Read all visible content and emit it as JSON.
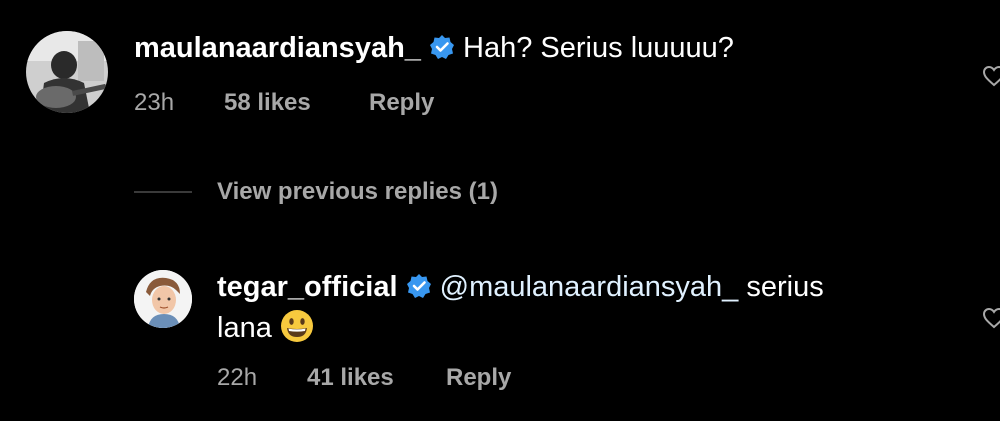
{
  "comment": {
    "username": "maulanaardiansyah_",
    "text": "Hah? Serius luuuuu?",
    "time": "23h",
    "likes": "58 likes",
    "reply_label": "Reply",
    "avatar_icon": "user-photo-guitar",
    "verified_icon": "verified-badge-icon",
    "like_icon": "heart-outline-icon"
  },
  "view_replies": {
    "label": "View previous replies (1)"
  },
  "reply": {
    "username": "tegar_official",
    "mention": "@maulanaardiansyah_",
    "text_line1_rest": " serius",
    "text_line2": "lana",
    "emoji": "grinning-face-emoji",
    "time": "22h",
    "likes": "41 likes",
    "reply_label": "Reply",
    "avatar_icon": "user-photo-illustration",
    "verified_icon": "verified-badge-icon",
    "like_icon": "heart-outline-icon"
  },
  "colors": {
    "background": "#000000",
    "primary_text": "#ffffff",
    "secondary_text": "#a8a8a8",
    "verified_blue": "#3897f0",
    "mention": "#e0f1ff"
  }
}
